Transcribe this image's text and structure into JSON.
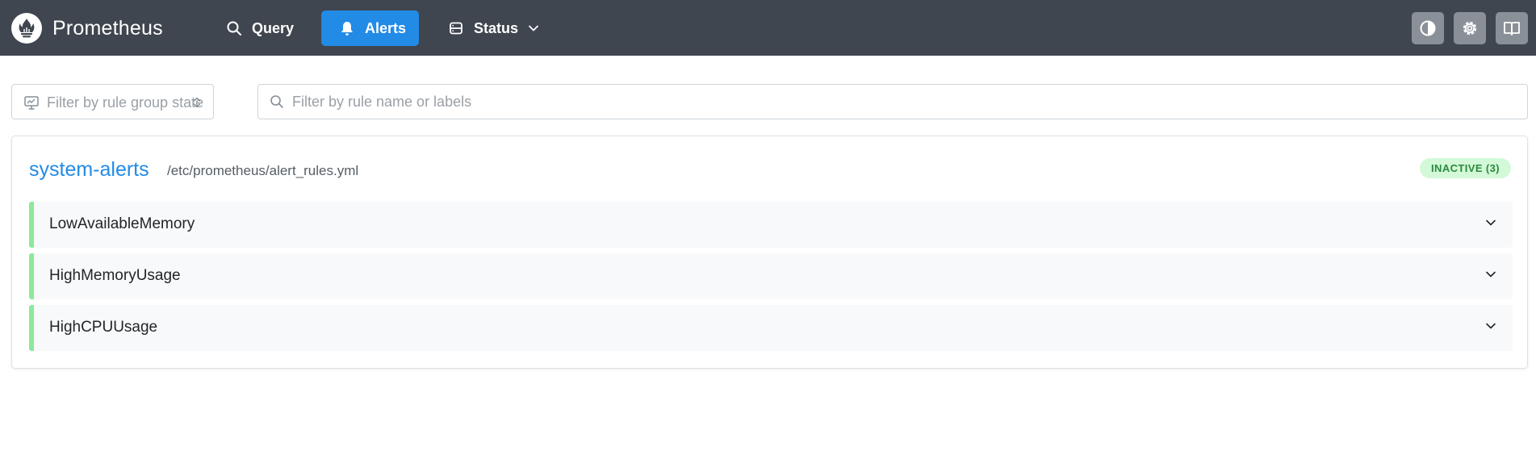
{
  "app": {
    "title": "Prometheus"
  },
  "nav": {
    "query_label": "Query",
    "alerts_label": "Alerts",
    "status_label": "Status"
  },
  "filters": {
    "state_placeholder": "Filter by rule group state",
    "name_placeholder": "Filter by rule name or labels"
  },
  "group": {
    "name": "system-alerts",
    "file": "/etc/prometheus/alert_rules.yml",
    "badge": "INACTIVE (3)"
  },
  "rules": [
    {
      "name": "LowAvailableMemory"
    },
    {
      "name": "HighMemoryUsage"
    },
    {
      "name": "HighCPUUsage"
    }
  ],
  "colors": {
    "header_bg": "#3f464f",
    "accent": "#228be6",
    "inactive_badge_bg": "#d3f9d8",
    "inactive_badge_text": "#2b8a3e",
    "rule_marker": "#8ce99a"
  }
}
